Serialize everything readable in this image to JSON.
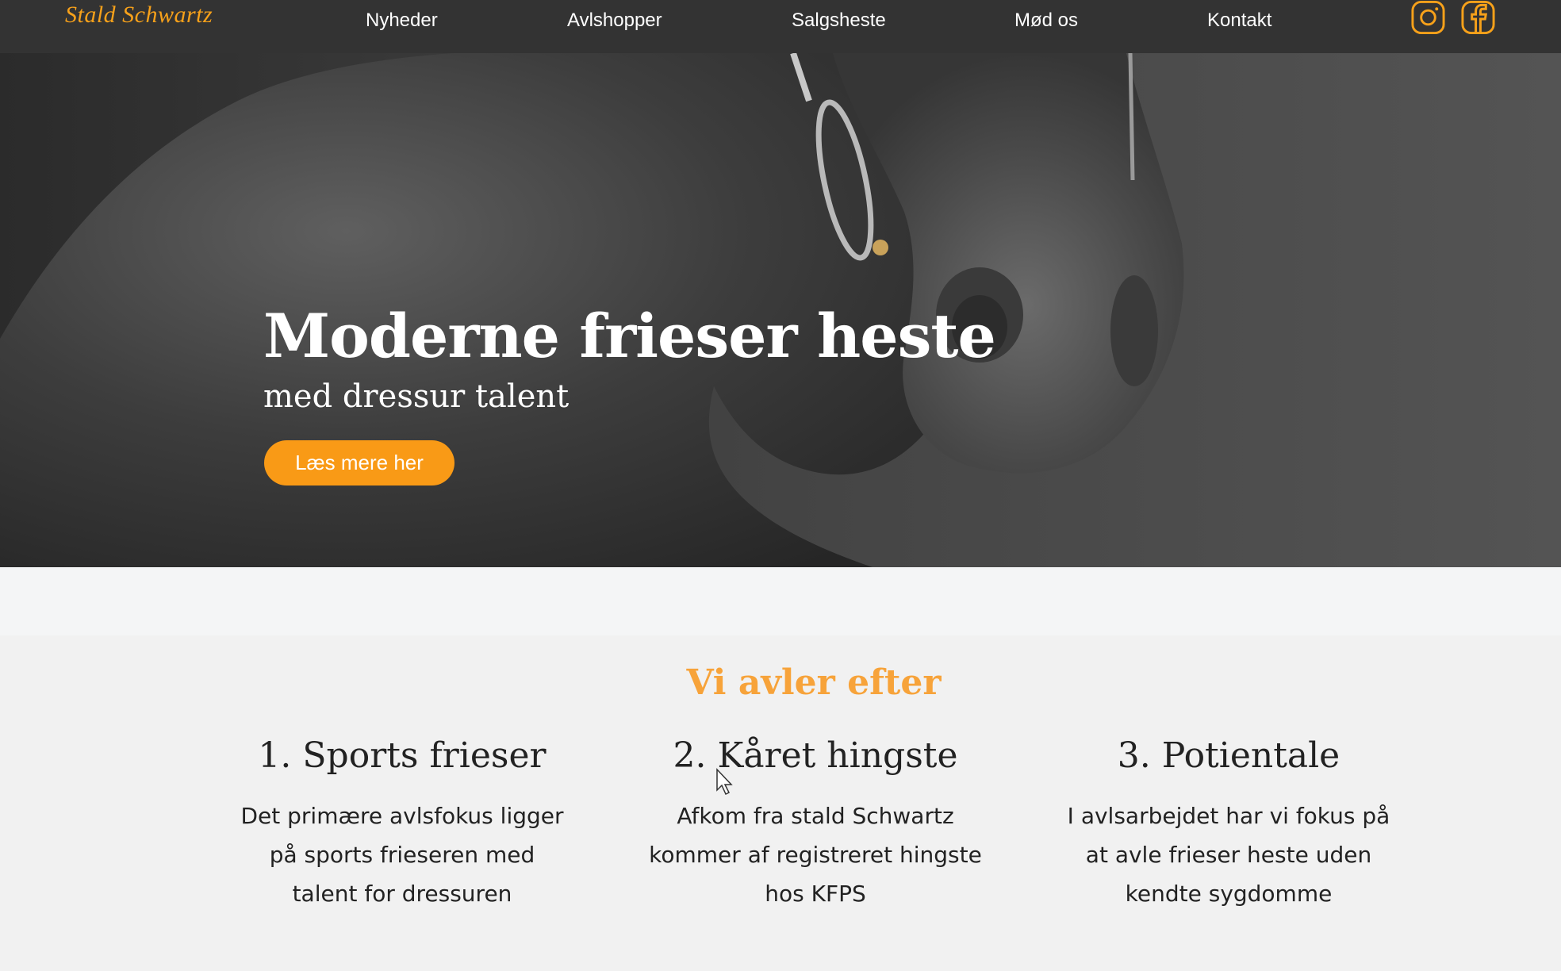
{
  "brand": {
    "logo": "Stald Schwartz",
    "accent": "#f7a11a"
  },
  "nav": {
    "items": [
      {
        "label": "Nyheder"
      },
      {
        "label": "Avlshopper"
      },
      {
        "label": "Salgsheste"
      },
      {
        "label": "Mød os"
      },
      {
        "label": "Kontakt"
      }
    ],
    "social": [
      {
        "icon": "instagram-icon"
      },
      {
        "icon": "facebook-icon"
      }
    ]
  },
  "hero": {
    "title": "Moderne frieser heste",
    "subtitle": "med dressur talent",
    "cta_label": "Læs mere her"
  },
  "features": {
    "title": "Vi avler efter",
    "items": [
      {
        "heading": "1. Sports frieser",
        "text": "Det primære avlsfokus ligger på sports frieseren med talent for dressuren"
      },
      {
        "heading": "2. Kåret hingste",
        "text": "Afkom fra stald Schwartz kommer af registreret hingste hos KFPS"
      },
      {
        "heading": "3. Potientale",
        "text": "I avlsarbejdet har vi fokus på at avle frieser heste uden kendte sygdomme"
      }
    ]
  }
}
